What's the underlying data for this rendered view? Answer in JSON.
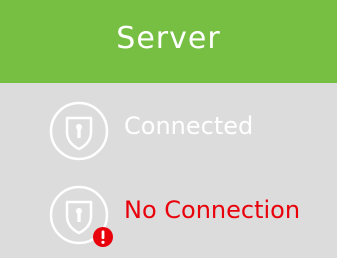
{
  "header": {
    "title": "Server"
  },
  "statuses": [
    {
      "label": "Connected",
      "icon": "shield-icon",
      "color": "#ffffff"
    },
    {
      "label": "No Connection",
      "icon": "shield-icon",
      "color": "#e8000b",
      "badge": "alert-icon",
      "badge_text": "!"
    }
  ],
  "colors": {
    "header_bg": "#76bf43",
    "body_bg": "#dcdcdc",
    "alert": "#e8000b"
  }
}
